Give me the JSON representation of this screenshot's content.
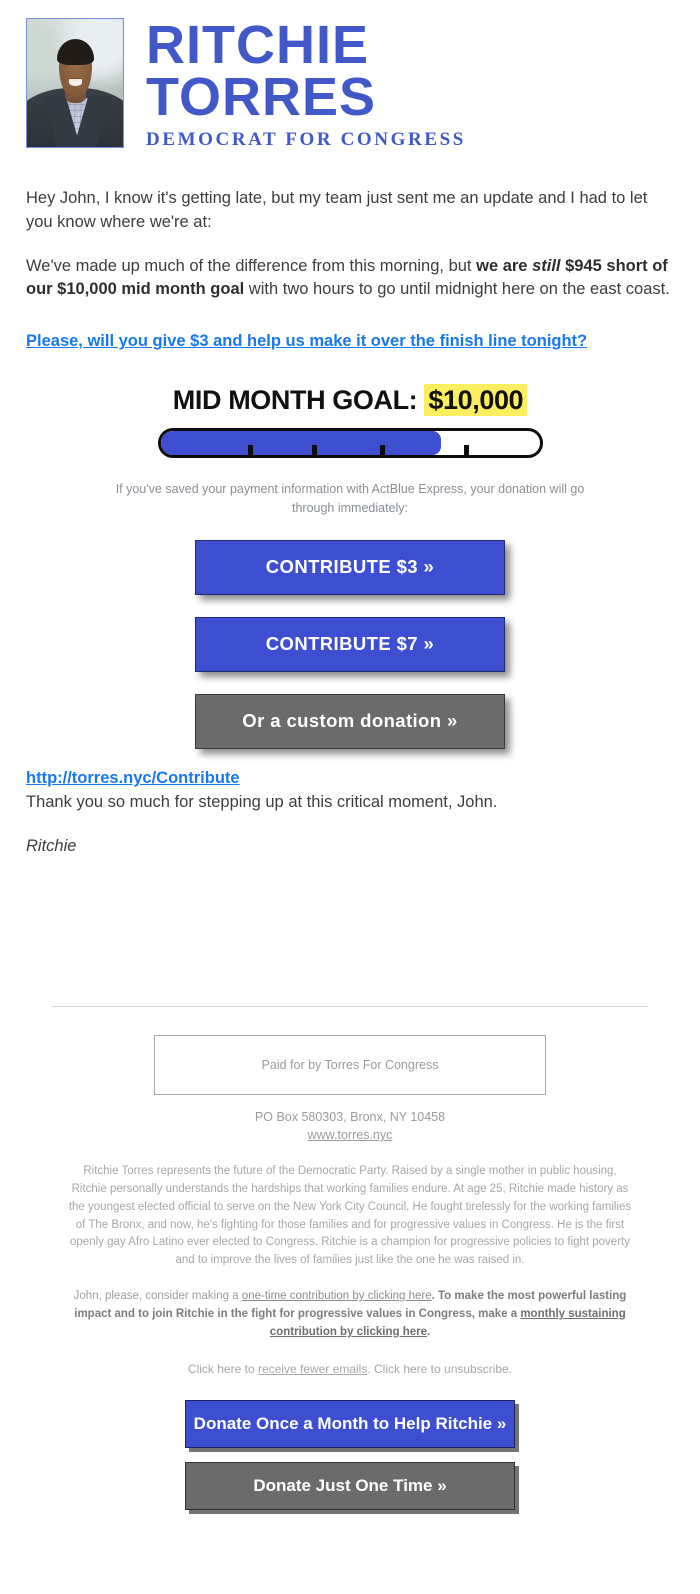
{
  "header": {
    "candidate_first": "RITCHIE",
    "candidate_last": "TORRES",
    "tagline": "DEMOCRAT FOR CONGRESS",
    "photo_alt": "Ritchie Torres headshot",
    "logo_color": "#4058c8"
  },
  "body": {
    "greeting_paragraph": "Hey John, I know it's getting late, but my team just sent me an update and I had to let you know where we're at:",
    "update_part1": "We've made up much of the difference from this morning, but ",
    "update_bold1": "we are ",
    "update_bold_italic": "still",
    "update_bold2": " $945 short of our $10,000 mid month goal",
    "update_part2": " with two hours to go until midnight here on the east coast.",
    "ask_link": "Please, will you give $3 and help us make it over the finish line tonight?",
    "contribute_url": "http://torres.nyc/Contribute",
    "thanks": "Thank you so much for stepping up at this critical moment, John.",
    "signature": "Ritchie"
  },
  "goal": {
    "title_label": "MID MONTH GOAL: ",
    "amount": "$10,000",
    "highlight_color": "#fbee61",
    "bar_fill_percent": 74,
    "bar_fill_color": "#3d4fd0",
    "tick_positions": [
      23,
      40,
      58,
      80
    ],
    "raised_short": "$945",
    "actblue_note": "If you've saved your payment information with ActBlue Express, your donation will go through immediately:"
  },
  "cta_buttons": [
    {
      "label": "CONTRIBUTE $3 »",
      "style": "blue"
    },
    {
      "label": "CONTRIBUTE $7 »",
      "style": "blue"
    },
    {
      "label": "Or a custom donation »",
      "style": "gray"
    }
  ],
  "footer": {
    "paid_for": "Paid for by Torres For Congress",
    "address": "PO Box 580303, Bronx, NY 10458",
    "website": "www.torres.nyc",
    "bio": "Ritchie Torres represents the future of the Democratic Party. Raised by a single mother in public housing, Ritchie personally understands the hardships that working families endure. At age 25, Ritchie made history as the youngest elected official to serve on the New York City Council. He fought tirelessly for the working families of The Bronx, and now, he's fighting for those families and for progressive values in Congress. He is the first openly gay Afro Latino ever elected to Congress. Ritchie is a champion for progressive policies to fight poverty and to improve the lives of families just like the one he was raised in.",
    "ask_prefix": "John, please, consider making a ",
    "ask_link_one_time": "one-time contribution by clicking here",
    "ask_middle": ". To make the most powerful lasting impact and to join Ritchie in the fight for progressive values in Congress, make a ",
    "ask_link_monthly": "monthly sustaining contribution by clicking here",
    "ask_suffix": ".",
    "unsub_prefix": "Click here to ",
    "unsub_link_fewer": "receive fewer emails",
    "unsub_middle": ". Click here to unsubscribe.",
    "buttons": [
      {
        "label": "Donate Once a Month to Help Ritchie »",
        "style": "blue"
      },
      {
        "label": "Donate Just One Time »",
        "style": "gray"
      }
    ]
  }
}
